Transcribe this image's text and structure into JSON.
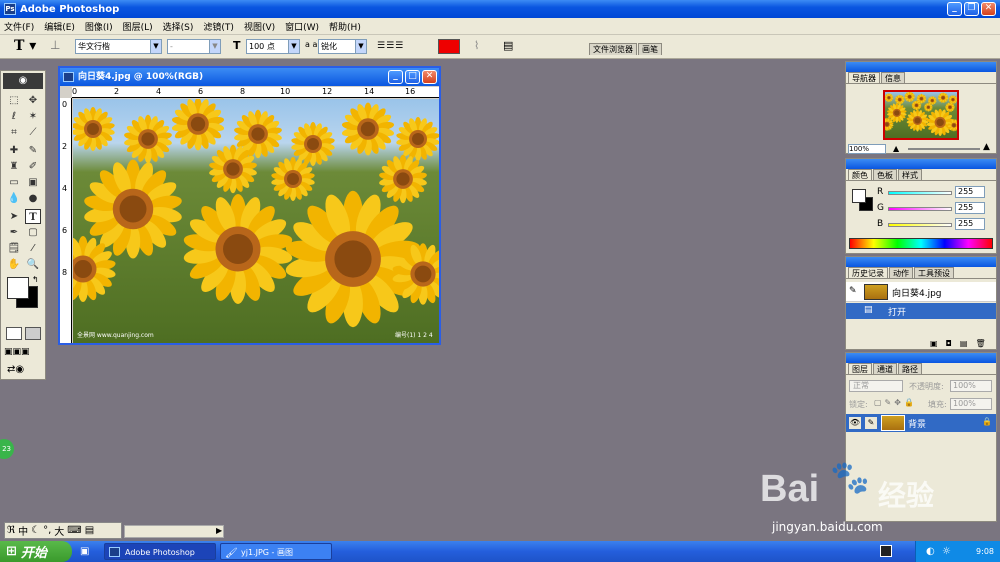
{
  "app": {
    "title": "Adobe Photoshop"
  },
  "menu": [
    "文件(F)",
    "编辑(E)",
    "图像(I)",
    "图层(L)",
    "选择(S)",
    "滤镜(T)",
    "视图(V)",
    "窗口(W)",
    "帮助(H)"
  ],
  "options": {
    "font_family": "华文行楷",
    "font_style": "-",
    "font_size": "100 点",
    "aa_label": "a a",
    "anti_alias": "锐化",
    "color": "#ee0000"
  },
  "dock_tabs": [
    "文件浏览器",
    "画笔"
  ],
  "document": {
    "title": "向日葵4.jpg @ 100%(RGB)",
    "ruler_h": [
      "0",
      "2",
      "4",
      "6",
      "8",
      "10",
      "12",
      "14",
      "16"
    ],
    "ruler_v": [
      "0",
      "2",
      "4",
      "6",
      "8"
    ],
    "watermark_left": "全景网 www.quanjing.com",
    "watermark_right": "编号(1) 1 2 4"
  },
  "navigator": {
    "tabs": [
      "导航器",
      "信息"
    ],
    "zoom": "100%"
  },
  "color_panel": {
    "tabs": [
      "颜色",
      "色板",
      "样式"
    ],
    "channels": [
      {
        "label": "R",
        "value": "255"
      },
      {
        "label": "G",
        "value": "255"
      },
      {
        "label": "B",
        "value": "255"
      }
    ]
  },
  "history": {
    "tabs": [
      "历史记录",
      "动作",
      "工具预设"
    ],
    "snapshot": "向日葵4.jpg",
    "steps": [
      "打开"
    ]
  },
  "layers": {
    "tabs": [
      "图层",
      "通道",
      "路径"
    ],
    "blend_mode": "正常",
    "opacity_label": "不透明度:",
    "opacity": "100%",
    "lock_label": "锁定:",
    "fill_label": "填充:",
    "fill": "100%",
    "layer_name": "背景"
  },
  "badge": "23",
  "ime": {
    "mode": "中",
    "width": "大"
  },
  "taskbar": {
    "start": "开始",
    "tasks": [
      "Adobe Photoshop",
      "yj1.JPG - 画图"
    ],
    "clock": "9:08"
  },
  "watermark": {
    "brand": "Bai",
    "brand_cn": "经验",
    "url": "jingyan.baidu.com"
  },
  "colors": {
    "accent": "#0a56e0",
    "foreground": "#ffffff",
    "background": "#000000"
  }
}
